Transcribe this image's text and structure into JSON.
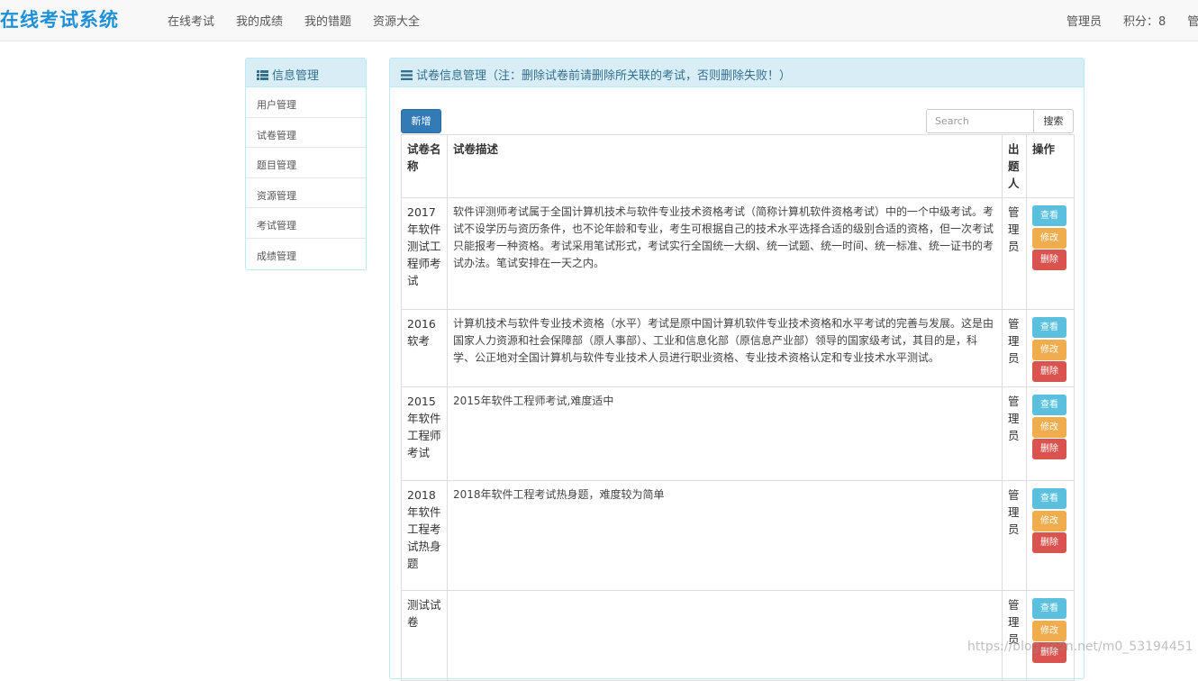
{
  "navbar": {
    "brand": "在线考试系统",
    "links": [
      "在线考试",
      "我的成绩",
      "我的错题",
      "资源大全"
    ],
    "user": "管理员",
    "points": "积分：8",
    "extra": "管"
  },
  "sidebar": {
    "title": "信息管理",
    "items": [
      "用户管理",
      "试卷管理",
      "题目管理",
      "资源管理",
      "考试管理",
      "成绩管理"
    ]
  },
  "panel": {
    "title": "试卷信息管理（注：删除试卷前请删除所关联的考试，否则删除失败！）",
    "add_label": "新增",
    "search_placeholder": "Search",
    "search_label": "搜索",
    "headers": [
      "试卷名称",
      "试卷描述",
      "出题人",
      "操作"
    ],
    "actions": {
      "view": "查看",
      "edit": "修改",
      "delete": "删除"
    },
    "rows": [
      {
        "name": "2017年软件测试工程师考试",
        "desc": "软件评测师考试属于全国计算机技术与软件专业技术资格考试（简称计算机软件资格考试）中的一个中级考试。考试不设学历与资历条件，也不论年龄和专业，考生可根据自己的技术水平选择合适的级别合适的资格，但一次考试只能报考一种资格。考试采用笔试形式，考试实行全国统一大纲、统一试题、统一时间、统一标准、统一证书的考试办法。笔试安排在一天之内。",
        "author": "管理员"
      },
      {
        "name": "2016软考",
        "desc": "计算机技术与软件专业技术资格（水平）考试是原中国计算机软件专业技术资格和水平考试的完善与发展。这是由国家人力资源和社会保障部（原人事部）、工业和信息化部（原信息产业部）领导的国家级考试，其目的是，科学、公正地对全国计算机与软件专业技术人员进行职业资格、专业技术资格认定和专业技术水平测试。",
        "author": "管理员"
      },
      {
        "name": "2015年软件工程师考试",
        "desc": "2015年软件工程师考试,难度适中",
        "author": "管理员"
      },
      {
        "name": "2018年软件工程考试热身题",
        "desc": "2018年软件工程考试热身题，难度较为简单",
        "author": "管理员"
      },
      {
        "name": "测试试卷",
        "desc": "",
        "author": "管理员"
      }
    ]
  },
  "watermark": "https://blog.csdn.net/m0_53194451"
}
